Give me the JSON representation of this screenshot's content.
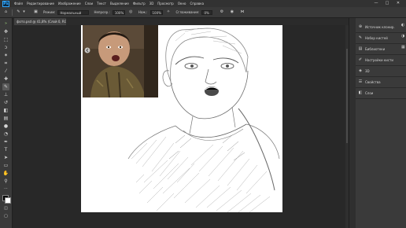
{
  "app": {
    "logo_text": "Ps"
  },
  "menu": {
    "items": [
      "Файл",
      "Редактирование",
      "Изображение",
      "Слои",
      "Текст",
      "Выделение",
      "Фильтр",
      "3D",
      "Просмотр",
      "Окно",
      "Справка"
    ]
  },
  "window_controls": {
    "minimize": "—",
    "maximize": "□",
    "close": "✕"
  },
  "options": {
    "mode_label": "Режим:",
    "mode_value": "Нормальный",
    "opacity_label": "Непрозр.:",
    "opacity_value": "100%",
    "flow_label": "Наж.:",
    "flow_value": "100%",
    "smoothing_label": "Сглаживание:",
    "smoothing_value": "0%"
  },
  "document": {
    "tab_title": "фото.psd @ 41,8% (Слой 0, RGB/8*)"
  },
  "right_panel": {
    "items": [
      {
        "label": "Источник клонир.",
        "icon": "clone-source-icon"
      },
      {
        "label": "Набор кистей",
        "icon": "brush-icon"
      },
      {
        "label": "Библиотеки",
        "icon": "library-icon"
      },
      {
        "label": "Настройки кисти",
        "icon": "brush-settings-icon"
      },
      {
        "label": "3D",
        "icon": "cube-icon"
      },
      {
        "label": "Свойства",
        "icon": "properties-icon"
      },
      {
        "label": "Слои",
        "icon": "layers-icon"
      }
    ]
  },
  "tools": [
    "move-icon",
    "marquee-icon",
    "lasso-icon",
    "magic-wand-icon",
    "crop-icon",
    "eyedropper-icon",
    "healing-icon",
    "brush-icon",
    "clone-stamp-icon",
    "history-brush-icon",
    "eraser-icon",
    "gradient-icon",
    "blur-icon",
    "dodge-icon",
    "pen-icon",
    "type-icon",
    "path-select-icon",
    "shape-icon",
    "hand-icon",
    "zoom-icon"
  ]
}
